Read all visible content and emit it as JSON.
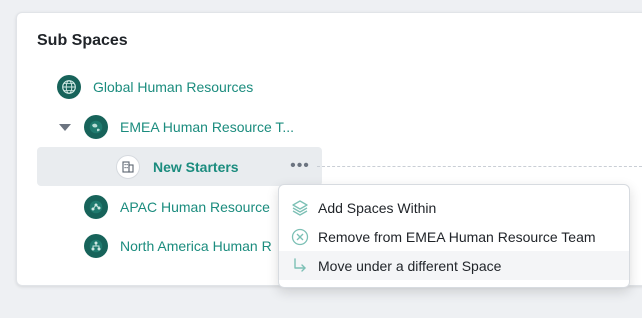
{
  "panel": {
    "title": "Sub Spaces"
  },
  "tree": {
    "items": [
      {
        "label": "Global Human Resources",
        "icon": "globe-icon"
      },
      {
        "label": "EMEA Human Resource T...",
        "icon": "world-map-icon",
        "expanded": true
      },
      {
        "label": "New Starters",
        "icon": "building-icon",
        "selected": true
      },
      {
        "label": "APAC Human Resource",
        "icon": "network-icon"
      },
      {
        "label": "North America Human R",
        "icon": "hierarchy-icon"
      }
    ],
    "more_label": "•••"
  },
  "context_menu": {
    "items": [
      {
        "label": "Add Spaces Within",
        "icon": "layers-icon"
      },
      {
        "label": "Remove from EMEA Human Resource Team",
        "icon": "remove-circle-icon"
      },
      {
        "label": "Move under a different Space",
        "icon": "move-arrow-icon",
        "hovered": true
      }
    ]
  },
  "colors": {
    "accent": "#1b8c7e",
    "avatar": "#17635a",
    "selected_row": "#e9ecef"
  }
}
